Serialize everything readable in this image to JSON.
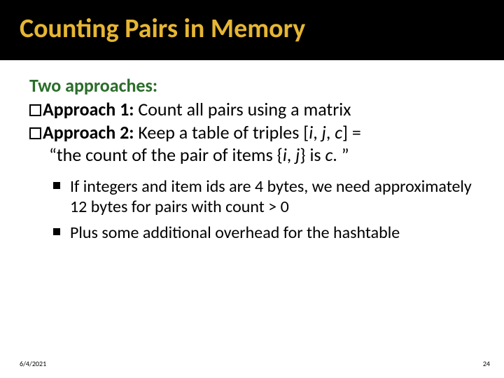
{
  "title": "Counting Pairs in Memory",
  "heading": "Two approaches:",
  "approach1": {
    "label": "Approach 1:",
    "text": " Count all pairs using a matrix"
  },
  "approach2": {
    "label": "Approach 2:",
    "text_pre": " Keep a table of triples [",
    "var_i": "i",
    "comma1": ", ",
    "var_j": "j",
    "comma2": ", ",
    "var_c": "c",
    "text_post": "] =",
    "line2_pre": "“the count of the pair of items {",
    "line2_i": "i",
    "line2_comma": ", ",
    "line2_j": "j",
    "line2_mid": "} is ",
    "line2_c": "c",
    "line2_post": ". ”"
  },
  "sub": [
    "If integers and item ids are 4 bytes, we need approximately 12 bytes for pairs with count > 0",
    "Plus some additional overhead for the hashtable"
  ],
  "footer": {
    "date": "6/4/2021",
    "page": "24"
  }
}
